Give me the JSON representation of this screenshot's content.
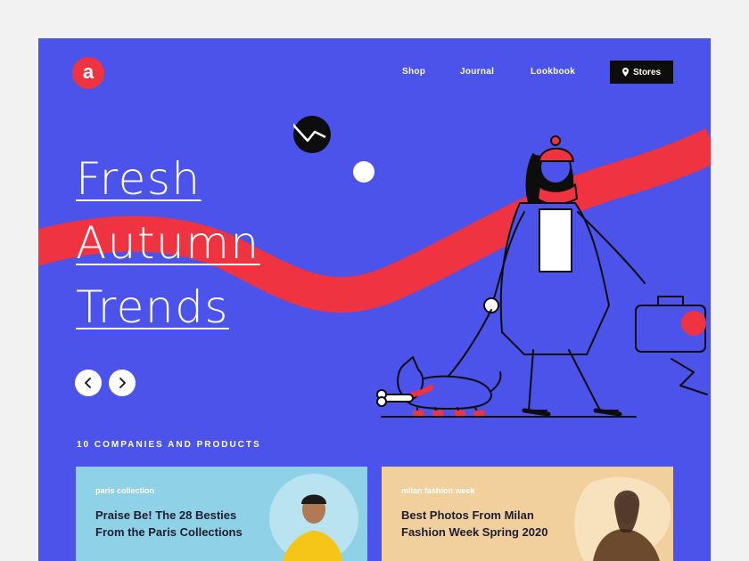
{
  "brand": {
    "logo_letter": "a",
    "accent_color": "#ef3340",
    "background_color": "#4b53ea"
  },
  "nav": {
    "items": [
      {
        "label": "Shop"
      },
      {
        "label": "Journal"
      },
      {
        "label": "Lookbook"
      }
    ],
    "stores_label": "Stores",
    "stores_icon": "location-pin-icon"
  },
  "hero": {
    "title_lines": [
      "Fresh",
      "Autumn",
      "Trends"
    ],
    "prev_icon": "chevron-left-icon",
    "next_icon": "chevron-right-icon"
  },
  "section": {
    "heading": "10 COMPANIES AND PRODUCTS"
  },
  "cards": [
    {
      "tag": "paris collection",
      "headline": "Praise Be! The 28 Besties From the Paris Collections",
      "color": "#8fd1e7"
    },
    {
      "tag": "milan fashion week",
      "headline": "Best Photos From Milan Fashion Week Spring 2020",
      "color": "#f2d09e"
    }
  ]
}
